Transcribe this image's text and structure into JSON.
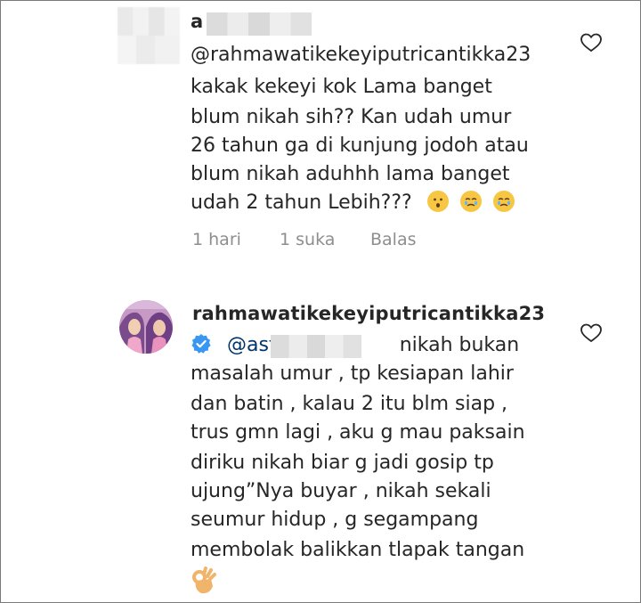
{
  "comment1": {
    "username": "a",
    "mention": "@rahmawatikekeyiputricantikka23",
    "lines": [
      "kakak kekeyi kok Lama banget",
      "blum nikah sih?? Kan udah umur",
      "26 tahun ga di kunjung jodoh atau",
      "blum nikah aduhhh lama banget",
      "udah 2 tahun Lebih???"
    ],
    "time": "1 hari",
    "likes": "1 suka",
    "reply": "Balas",
    "emojis": [
      "hushed-face-emoji",
      "crying-face-emoji",
      "crying-face-emoji"
    ]
  },
  "comment2": {
    "username": "rahmawatikekeyiputricantikka23",
    "mention": "@asti",
    "lines": [
      "nikah bukan",
      "masalah umur , tp kesiapan lahir",
      "dan batin , kalau 2 itu blm siap ,",
      "trus gmn lagi , aku g mau paksain",
      "diriku nikah biar g jadi gosip tp",
      "ujung”Nya buyar , nikah sekali",
      "seumur hidup , g segampang",
      "membolak balikkan tlapak tangan"
    ],
    "emoji": "ok-hand-emoji"
  },
  "colors": {
    "text": "#262626",
    "mention": "#003569",
    "meta": "#8e8e8e",
    "verified": "#3897f0"
  }
}
